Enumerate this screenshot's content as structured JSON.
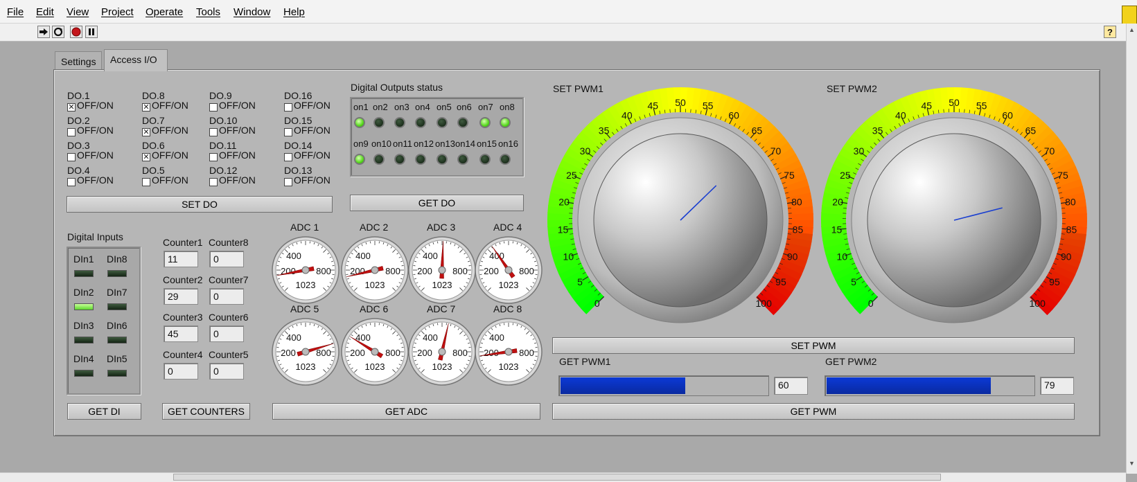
{
  "menu": [
    "File",
    "Edit",
    "View",
    "Project",
    "Operate",
    "Tools",
    "Window",
    "Help"
  ],
  "help_icon": "?",
  "tabs": [
    "Settings",
    "Access I/O"
  ],
  "do_labels": [
    "DO.1",
    "DO.8",
    "DO.9",
    "DO.16",
    "DO.2",
    "DO.7",
    "DO.10",
    "DO.15",
    "DO.3",
    "DO.6",
    "DO.11",
    "DO.14",
    "DO.4",
    "DO.5",
    "DO.12",
    "DO.13"
  ],
  "do_checked": [
    true,
    true,
    false,
    false,
    false,
    true,
    false,
    false,
    false,
    true,
    false,
    false,
    false,
    false,
    false,
    false
  ],
  "off_on": "OFF/ON",
  "check_mark": "✕",
  "set_do": "SET DO",
  "do_status": {
    "title": "Digital Outputs status",
    "labels": [
      "on1",
      "on2",
      "on3",
      "on4",
      "on5",
      "on6",
      "on7",
      "on8",
      "on9",
      "on10",
      "on11",
      "on12",
      "on13",
      "on14",
      "on15",
      "on16"
    ],
    "states": [
      true,
      false,
      false,
      false,
      false,
      false,
      true,
      true,
      true,
      false,
      false,
      false,
      false,
      false,
      false,
      false
    ]
  },
  "get_do": "GET DO",
  "di": {
    "title": "Digital Inputs",
    "labels": [
      "DIn1",
      "DIn8",
      "DIn2",
      "DIn7",
      "DIn3",
      "DIn6",
      "DIn4",
      "DIn5"
    ],
    "states": [
      false,
      false,
      true,
      false,
      false,
      false,
      false,
      false
    ]
  },
  "get_di": "GET DI",
  "counters": {
    "labels": [
      "Counter1",
      "Counter8",
      "Counter2",
      "Counter7",
      "Counter3",
      "Counter6",
      "Counter4",
      "Counter5"
    ],
    "values": [
      "11",
      "0",
      "29",
      "0",
      "45",
      "0",
      "0",
      "0"
    ]
  },
  "get_counters": "GET COUNTERS",
  "adc": {
    "labels": [
      "ADC 1",
      "ADC 2",
      "ADC 3",
      "ADC 4",
      "ADC 5",
      "ADC 6",
      "ADC 7",
      "ADC 8"
    ],
    "values": [
      130,
      120,
      520,
      380,
      790,
      290,
      560,
      140
    ],
    "max": 1023,
    "scale": [
      "200",
      "400",
      "800",
      "1023"
    ]
  },
  "get_adc": "GET ADC",
  "pwm": {
    "set1_label": "SET PWM1",
    "set2_label": "SET PWM2",
    "set1_value": 67,
    "set2_value": 78,
    "ticks": [
      "0",
      "5",
      "10",
      "15",
      "20",
      "25",
      "30",
      "35",
      "40",
      "45",
      "50",
      "55",
      "60",
      "65",
      "70",
      "75",
      "80",
      "85",
      "90",
      "95",
      "100"
    ],
    "set_button": "SET PWM",
    "get1_label": "GET PWM1",
    "get2_label": "GET PWM2",
    "get1_value": "60",
    "get2_value": "79",
    "get_button": "GET PWM",
    "bar_color": "#0b39d6"
  }
}
